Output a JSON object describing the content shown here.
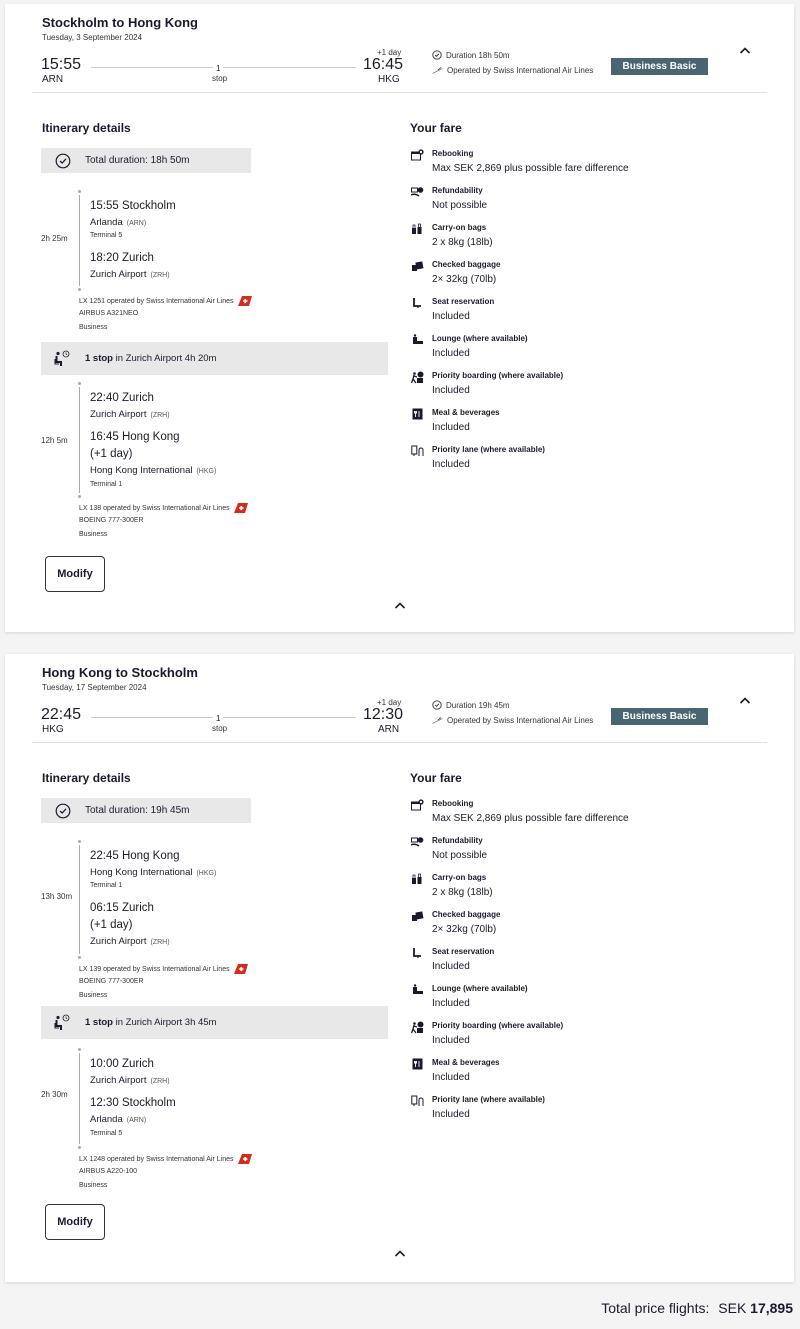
{
  "colors": {
    "fare_badge_bg": "#4a6572",
    "gray_box": "#e8e8e8",
    "text": "#1a1a2e",
    "swiss_red": "#d52b1e"
  },
  "trips": [
    {
      "title": "Stockholm to Hong Kong",
      "date": "Tuesday, 3 September 2024",
      "dep_time": "15:55",
      "dep_code": "ARN",
      "stops_num": "1",
      "stops_label": "stop",
      "plus_day": "+1 day",
      "arr_time": "16:45",
      "arr_code": "HKG",
      "duration": "Duration 18h 50m",
      "operated": "Operated by Swiss International Air Lines",
      "fare_name": "Business Basic",
      "itinerary_title": "Itinerary details",
      "total_duration": "Total duration: 18h 50m",
      "segments": [
        {
          "duration": "2h 25m",
          "from_city": "15:55 Stockholm",
          "from_airport": "Arlanda",
          "from_code": "(ARN)",
          "from_terminal": "Terminal 5",
          "to_city": "18:20 Zurich",
          "to_plusday": "",
          "to_airport": "Zurich Airport",
          "to_code": "(ZRH)",
          "to_terminal": "",
          "flight": "LX 1251  operated by Swiss International Air Lines",
          "aircraft": "AIRBUS A321NEO",
          "cabin": "Business"
        },
        {
          "duration": "12h 5m",
          "from_city": "22:40 Zurich",
          "from_airport": "Zurich Airport",
          "from_code": "(ZRH)",
          "from_terminal": "",
          "to_city": "16:45 Hong Kong",
          "to_plusday": "(+1 day)",
          "to_airport": "Hong Kong International",
          "to_code": "(HKG)",
          "to_terminal": "Terminal 1",
          "flight": "LX 138  operated by Swiss International Air Lines",
          "aircraft": "BOEING 777-300ER",
          "cabin": "Business"
        }
      ],
      "layover": {
        "bold": "1 stop",
        "text": " in Zurich Airport 4h 20m"
      },
      "modify_label": "Modify"
    },
    {
      "title": "Hong Kong to Stockholm",
      "date": "Tuesday, 17 September 2024",
      "dep_time": "22:45",
      "dep_code": "HKG",
      "stops_num": "1",
      "stops_label": "stop",
      "plus_day": "+1 day",
      "arr_time": "12:30",
      "arr_code": "ARN",
      "duration": "Duration 19h 45m",
      "operated": "Operated by Swiss International Air Lines",
      "fare_name": "Business Basic",
      "itinerary_title": "Itinerary details",
      "total_duration": "Total duration: 19h 45m",
      "segments": [
        {
          "duration": "13h 30m",
          "from_city": "22:45 Hong Kong",
          "from_airport": "Hong Kong International",
          "from_code": "(HKG)",
          "from_terminal": "Terminal 1",
          "to_city": "06:15 Zurich",
          "to_plusday": "(+1 day)",
          "to_airport": "Zurich Airport",
          "to_code": "(ZRH)",
          "to_terminal": "",
          "flight": "LX 139  operated by Swiss International Air Lines",
          "aircraft": "BOEING 777-300ER",
          "cabin": "Business"
        },
        {
          "duration": "2h 30m",
          "from_city": "10:00 Zurich",
          "from_airport": "Zurich Airport",
          "from_code": "(ZRH)",
          "from_terminal": "",
          "to_city": "12:30 Stockholm",
          "to_plusday": "",
          "to_airport": "Arlanda",
          "to_code": "(ARN)",
          "to_terminal": "Terminal 5",
          "flight": "LX 1248  operated by Swiss International Air Lines",
          "aircraft": "AIRBUS A220-100",
          "cabin": "Business"
        }
      ],
      "layover": {
        "bold": "1 stop",
        "text": " in Zurich Airport 3h 45m"
      },
      "modify_label": "Modify"
    }
  ],
  "fare": {
    "title": "Your fare",
    "items": [
      {
        "icon": "rebooking-icon",
        "title": "Rebooking",
        "value": "Max SEK 2,869 plus possible fare difference"
      },
      {
        "icon": "refund-icon",
        "title": "Refundability",
        "value": "Not possible"
      },
      {
        "icon": "carry-on-icon",
        "title": "Carry-on bags",
        "value": "2 x 8kg (18lb)"
      },
      {
        "icon": "checked-baggage-icon",
        "title": "Checked baggage",
        "value": "2× 32kg (70lb)"
      },
      {
        "icon": "seat-icon",
        "title": "Seat reservation",
        "value": "Included"
      },
      {
        "icon": "lounge-icon",
        "title": "Lounge (where available)",
        "value": "Included"
      },
      {
        "icon": "priority-boarding-icon",
        "title": "Priority boarding (where available)",
        "value": "Included"
      },
      {
        "icon": "meal-icon",
        "title": "Meal & beverages",
        "value": "Included"
      },
      {
        "icon": "priority-lane-icon",
        "title": "Priority lane (where available)",
        "value": "Included"
      }
    ]
  },
  "total": {
    "label": "Total price flights:",
    "currency": "SEK",
    "amount": "17,895"
  }
}
